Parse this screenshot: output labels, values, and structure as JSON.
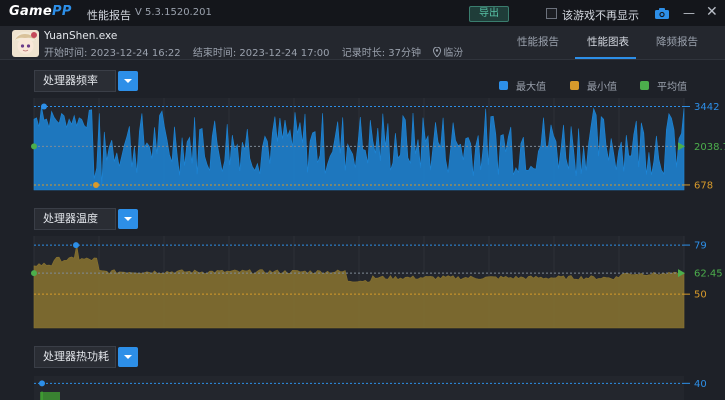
{
  "app": {
    "logo_main": "Game",
    "logo_accent": "PP",
    "title": "性能报告",
    "version": "V 5.3.1520.201",
    "export_label": "导出",
    "no_show_label": "该游戏不再显示"
  },
  "session": {
    "exe": "YuanShen.exe",
    "start": "开始时间: 2023-12-24 16:22",
    "end": "结束时间: 2023-12-24 17:00",
    "duration": "记录时长: 37分钟",
    "location": "临汾"
  },
  "tabs": [
    {
      "label": "性能报告"
    },
    {
      "label": "性能图表"
    },
    {
      "label": "降频报告"
    }
  ],
  "legend": {
    "max": "最大值",
    "min": "最小值",
    "avg": "平均值"
  },
  "colors": {
    "max": "#2d8fe8",
    "min": "#d79a2b",
    "avg": "#4cae4c",
    "freq_fill": "#1d86d8",
    "temp_fill": "#8a7430",
    "power_fill": "#3f9a32"
  },
  "sections": [
    {
      "label": "处理器频率",
      "max_label": "3442",
      "avg_label": "2038.75",
      "min_label": "678"
    },
    {
      "label": "处理器温度",
      "max_label": "79",
      "avg_label": "62.45",
      "min_label": "50"
    },
    {
      "label": "处理器热功耗",
      "max_label": "40"
    }
  ],
  "chart_data": [
    {
      "type": "area",
      "title": "处理器频率",
      "max": 3442,
      "avg": 2038.75,
      "min": 678,
      "ylim": [
        500,
        3600
      ],
      "note": "dense fluctuating series between ~800 and ~3400"
    },
    {
      "type": "area",
      "title": "处理器温度",
      "max": 79,
      "avg": 62.45,
      "min": 50,
      "ylim": [
        30,
        82
      ]
    },
    {
      "type": "area",
      "title": "处理器热功耗",
      "max": 40,
      "ylim": [
        0,
        42
      ]
    }
  ]
}
